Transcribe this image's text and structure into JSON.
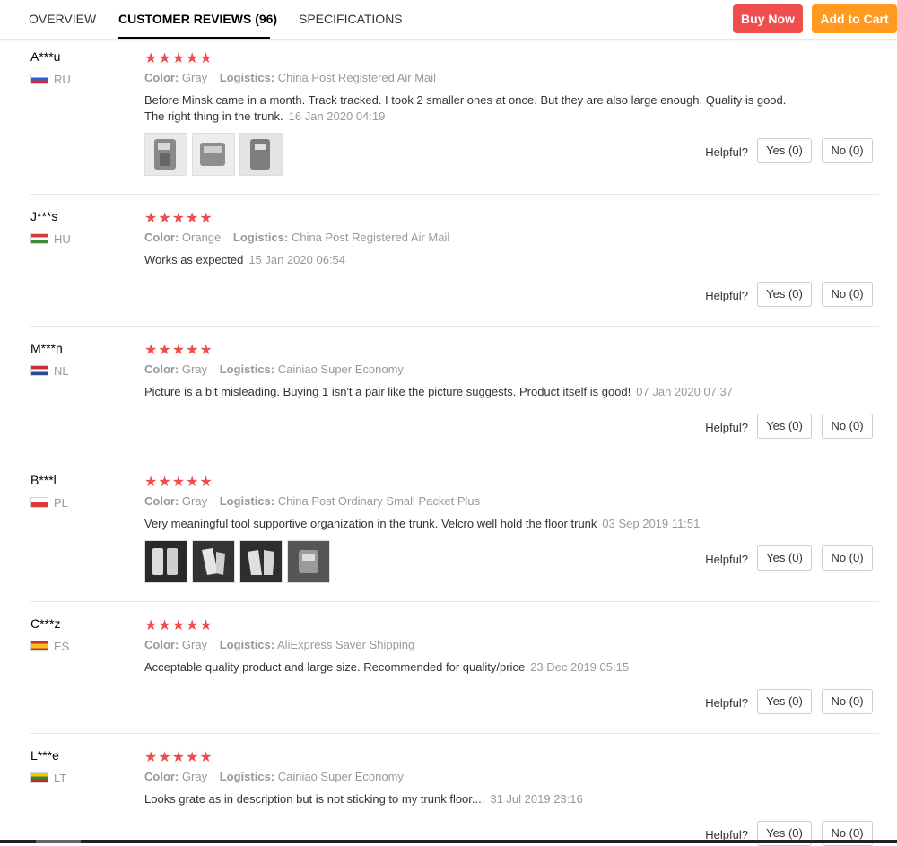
{
  "tabs": [
    {
      "label": "OVERVIEW"
    },
    {
      "label": "CUSTOMER REVIEWS (96)"
    },
    {
      "label": "SPECIFICATIONS"
    }
  ],
  "actions": {
    "buy_now": "Buy Now",
    "add_to_cart": "Add to Cart"
  },
  "colors": {
    "buy_now": "#f04d4d",
    "add_to_cart": "#ff9a1e",
    "stars": "#ee4e4e"
  },
  "labels": {
    "color": "Color:",
    "logistics": "Logistics:",
    "helpful": "Helpful?"
  },
  "reviews": [
    {
      "name": "A***u",
      "country": "RU",
      "stars": "★★★★★",
      "color": "Gray",
      "logistics": "China Post Registered Air Mail",
      "text": "Before Minsk came in a month. Track tracked. I took 2 smaller ones at once. But they are also large enough. Quality is good. The right thing in the trunk.",
      "date": "16 Jan 2020 04:19",
      "yes": "Yes (0)",
      "no": "No (0)",
      "photos": 3
    },
    {
      "name": "J***s",
      "country": "HU",
      "stars": "★★★★★",
      "color": "Orange",
      "logistics": "China Post Registered Air Mail",
      "text": "Works as expected",
      "date": "15 Jan 2020 06:54",
      "yes": "Yes (0)",
      "no": "No (0)",
      "photos": 0
    },
    {
      "name": "M***n",
      "country": "NL",
      "stars": "★★★★★",
      "color": "Gray",
      "logistics": "Cainiao Super Economy",
      "text": "Picture is a bit misleading. Buying 1 isn't a pair like the picture suggests. Product itself is good!",
      "date": "07 Jan 2020 07:37",
      "yes": "Yes (0)",
      "no": "No (0)",
      "photos": 0
    },
    {
      "name": "B***l",
      "country": "PL",
      "stars": "★★★★★",
      "color": "Gray",
      "logistics": "China Post Ordinary Small Packet Plus",
      "text": "Very meaningful tool supportive organization in the trunk. Velcro well hold the floor trunk",
      "date": "03 Sep 2019 11:51",
      "yes": "Yes (0)",
      "no": "No (0)",
      "photos": 4
    },
    {
      "name": "C***z",
      "country": "ES",
      "stars": "★★★★★",
      "color": "Gray",
      "logistics": "AliExpress Saver Shipping",
      "text": "Acceptable quality product and large size. Recommended for quality/price",
      "date": "23 Dec 2019 05:15",
      "yes": "Yes (0)",
      "no": "No (0)",
      "photos": 0
    },
    {
      "name": "L***e",
      "country": "LT",
      "stars": "★★★★★",
      "color": "Gray",
      "logistics": "Cainiao Super Economy",
      "text": "Looks grate as in description but is not sticking to my trunk floor....",
      "date": "31 Jul 2019 23:16",
      "yes": "Yes (0)",
      "no": "No (0)",
      "photos": 0
    }
  ]
}
